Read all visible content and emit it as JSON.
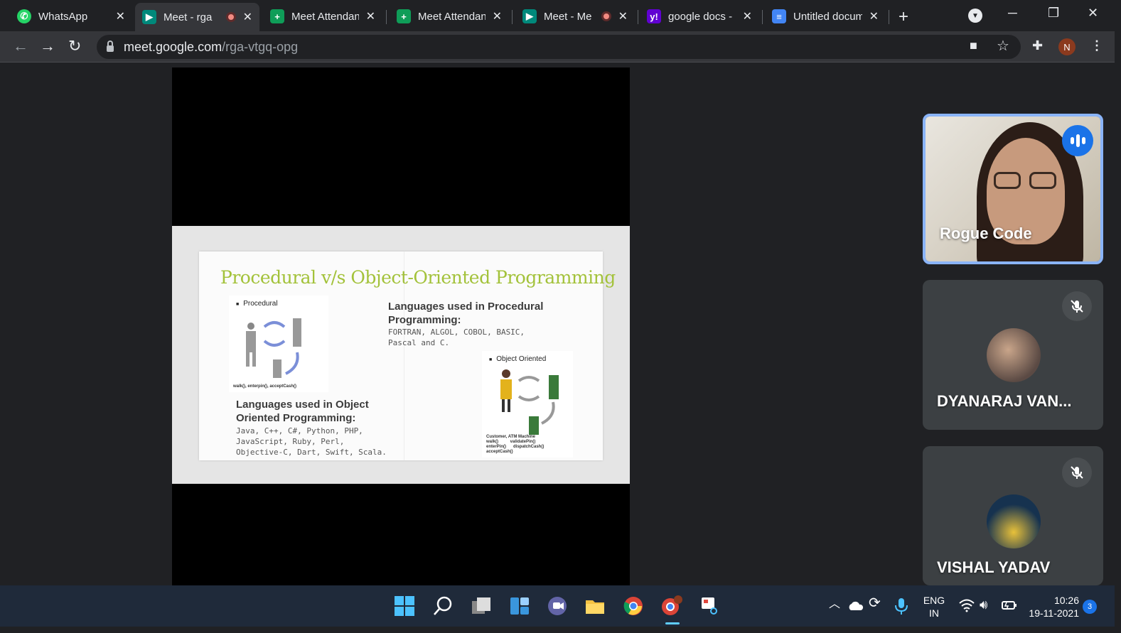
{
  "browser": {
    "tabs": [
      {
        "title": "WhatsApp",
        "icon": "whatsapp-icon",
        "recording": false,
        "active": false
      },
      {
        "title": "Meet - rga",
        "icon": "google-meet-icon",
        "recording": true,
        "active": true
      },
      {
        "title": "Meet Attendan",
        "icon": "google-sheets-icon",
        "recording": false,
        "active": false
      },
      {
        "title": "Meet Attendan",
        "icon": "google-sheets-icon",
        "recording": false,
        "active": false
      },
      {
        "title": "Meet - Me",
        "icon": "google-meet-icon",
        "recording": true,
        "active": false
      },
      {
        "title": "google docs - ",
        "icon": "yahoo-icon",
        "recording": false,
        "active": false
      },
      {
        "title": "Untitled docum",
        "icon": "google-docs-icon",
        "recording": false,
        "active": false
      }
    ],
    "new_tab": "+",
    "url_host": "meet.google.com",
    "url_path": "/rga-vtgq-opg",
    "profile_initial": "N"
  },
  "slide": {
    "title": "Procedural v/s Object-Oriented Programming",
    "procedural_caption": "Procedural",
    "procedural_footer": "walk(), enterpin(), acceptCash()",
    "oo_caption": "Object Oriented",
    "oo_footer": "Customer, ATM Machine\nwalk()          validatePin()\nenterPin()      dispatchCash()\nacceptCash()",
    "procedural_heading": "Languages used in Procedural Programming:",
    "procedural_languages": "FORTRAN, ALGOL, COBOL, BASIC,\nPascal and C.",
    "oo_heading": "Languages used in Object Oriented Programming:",
    "oo_languages": "Java, C++, C#, Python, PHP,\nJavaScript, Ruby, Perl,\nObjective-C, Dart, Swift, Scala."
  },
  "participants": [
    {
      "name": "Rogue Code",
      "speaking": true,
      "muted": false
    },
    {
      "name": "DYANARAJ VAN...",
      "speaking": false,
      "muted": true
    },
    {
      "name": "VISHAL YADAV",
      "speaking": false,
      "muted": true
    }
  ],
  "taskbar": {
    "language": "ENG",
    "region": "IN",
    "time": "10:26",
    "date": "19-11-2021",
    "notifications": "3"
  },
  "colors": {
    "slide_title": "#a3c23a",
    "speaking_border": "#8ab4f8",
    "taskbar": "#1f2a3a"
  }
}
